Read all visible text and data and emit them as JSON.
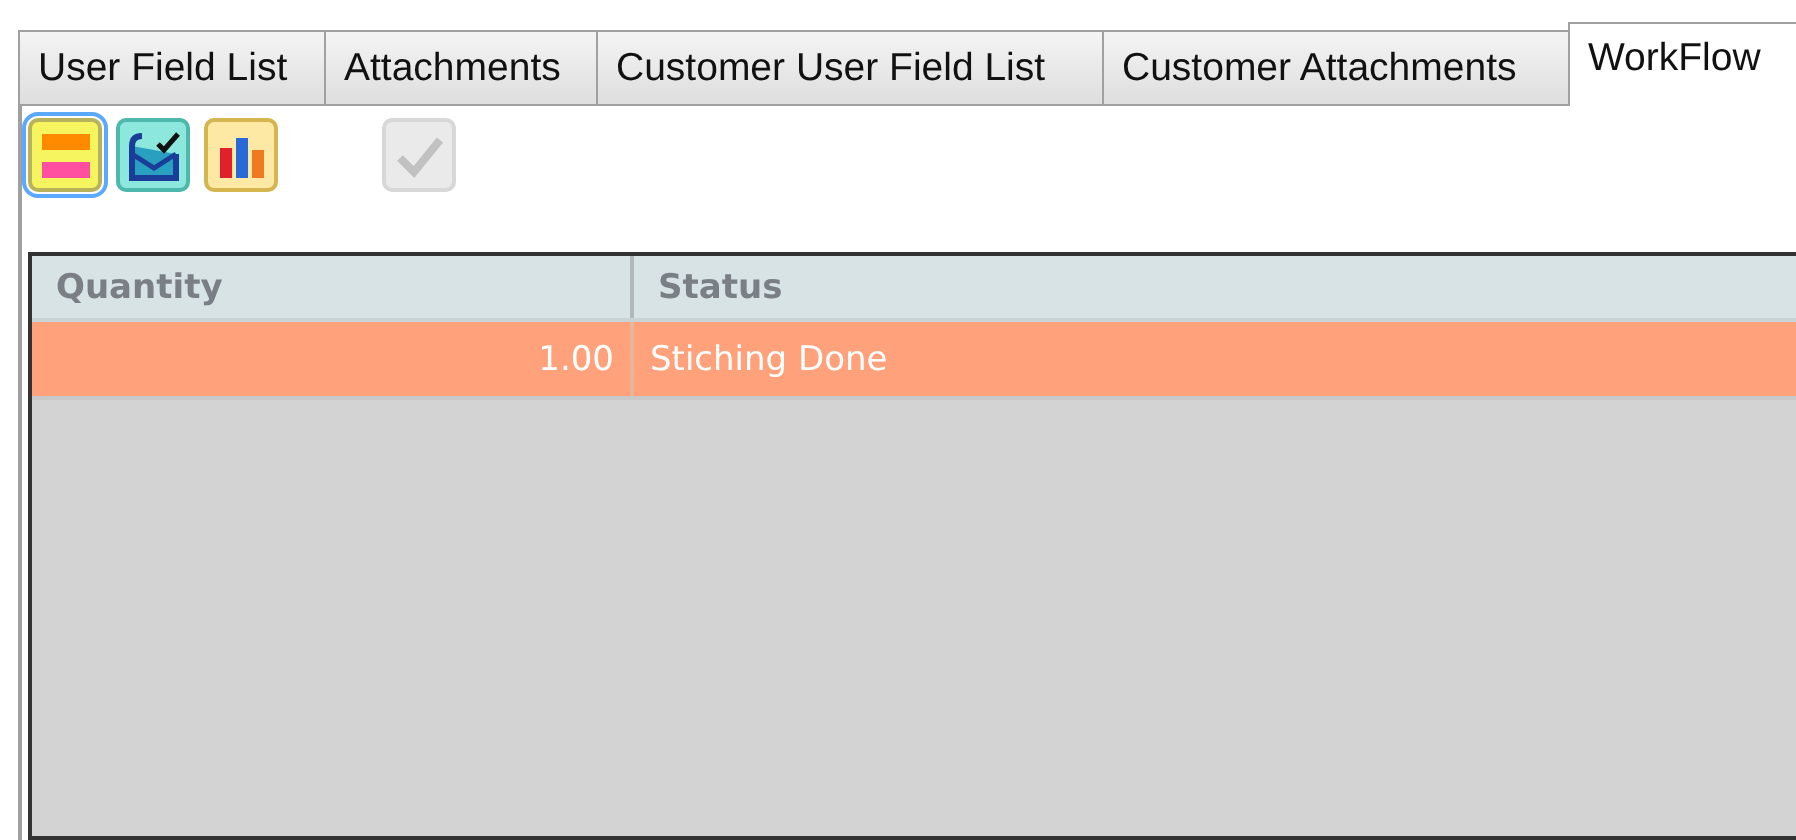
{
  "tabs": [
    {
      "label": "User Field List",
      "selected": false
    },
    {
      "label": "Attachments",
      "selected": false
    },
    {
      "label": "Customer User Field List",
      "selected": false
    },
    {
      "label": "Customer Attachments",
      "selected": false
    },
    {
      "label": "WorkFlow",
      "selected": true
    }
  ],
  "toolbar": [
    {
      "kind": "stack",
      "selected": true,
      "disabled": false
    },
    {
      "kind": "mail",
      "selected": false,
      "disabled": false
    },
    {
      "kind": "chart",
      "selected": false,
      "disabled": false
    },
    {
      "kind": "check",
      "selected": false,
      "disabled": true
    }
  ],
  "table": {
    "columns": [
      "Quantity",
      "Status"
    ],
    "rows": [
      {
        "cells": [
          "1.00",
          "Stiching Done"
        ],
        "selected": true
      }
    ]
  }
}
